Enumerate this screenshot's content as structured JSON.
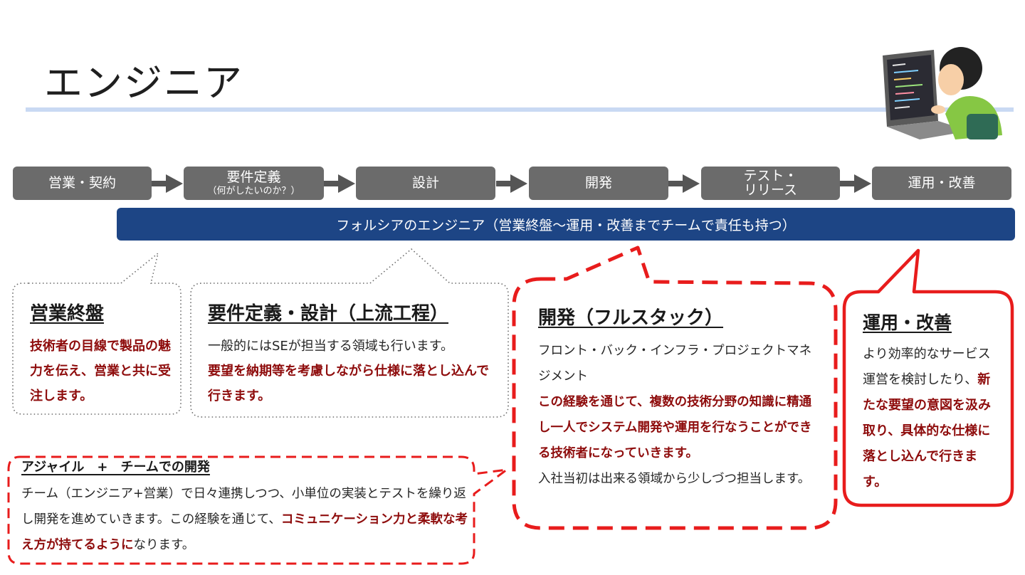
{
  "page": {
    "title": "エンジニア"
  },
  "flow": {
    "steps": [
      {
        "label": "営業・契約",
        "sub": ""
      },
      {
        "label": "要件定義",
        "sub": "（何がしたいのか？）"
      },
      {
        "label": "設計",
        "sub": ""
      },
      {
        "label": "開発",
        "sub": ""
      },
      {
        "label": "テスト・",
        "sub": "リリース"
      },
      {
        "label": "運用・改善",
        "sub": ""
      }
    ],
    "team_bar": "フォルシアのエンジニア（営業終盤～運用・改善までチームで責任も持つ）"
  },
  "sales": {
    "title": "営業終盤",
    "body_red": "技術者の目線で製品の魅力を伝え、営業と共に受注します。"
  },
  "requirements": {
    "title": "要件定義・設計（上流工程）",
    "body": "一般的にはSEが担当する領域も行います。",
    "body_red": "要望を納期等を考慮しながら仕様に落とし込んで行きます。"
  },
  "development": {
    "title": "開発（フルスタック）",
    "body1": "フロント・バック・インフラ・プロジェクトマネジメント",
    "body_red": "この経験を通じて、複数の技術分野の知識に精通し一人でシステム開発や運用を行なうことができる技術者になっていきます。",
    "body2": "入社当初は出来る領域から少しづつ担当します。"
  },
  "operations": {
    "title": "運用・改善",
    "body": "より効率的なサービス運営を検討したり、",
    "body_red": "新たな要望の意図を汲み取り、具体的な仕様に落とし込んで行きます。"
  },
  "agile": {
    "title": "アジャイル　+　チームでの開発",
    "body": "チーム（エンジニア+営業）で日々連携しつつ、小単位の実装とテストを繰り返し開発を進めていきます。この経験を通じて、",
    "body_red": "コミュニケーション力と柔軟な考え方が持てるように",
    "body_end": "なります。"
  },
  "colors": {
    "step_gray": "#6b6b6b",
    "team_blue": "#1d4585",
    "accent_red": "#8e0c0c",
    "callout_red": "#e81c1c",
    "title_rule": "#c9d9f3"
  },
  "illustration": {
    "icon": "engineer-at-laptop-illustration"
  }
}
